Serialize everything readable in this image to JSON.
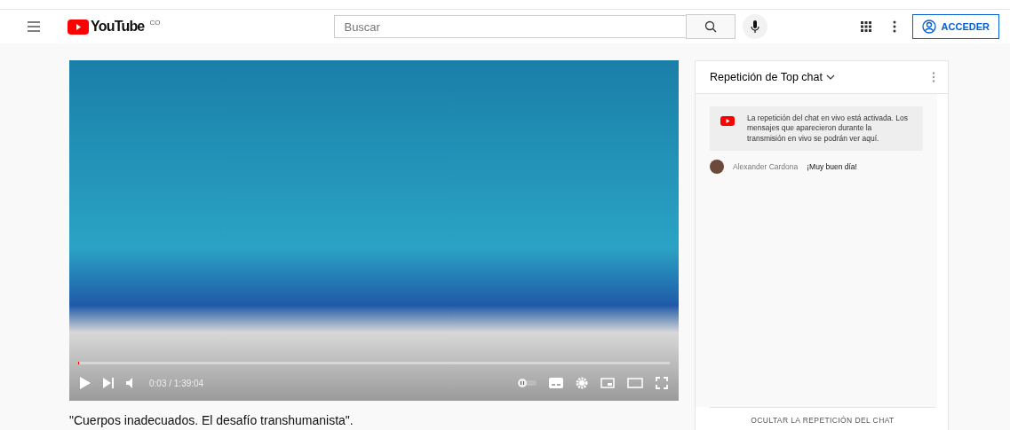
{
  "header": {
    "logo_text": "YouTube",
    "country": "CO",
    "search": {
      "placeholder": "Buscar"
    },
    "sign_in": "ACCEDER"
  },
  "player": {
    "progress": {
      "level": 0.001
    },
    "time": "0:03 / 1:39:04"
  },
  "video_title": "\"Cuerpos inadecuados. El desafío transhumanista\".",
  "chat": {
    "title": "Repetición de Top chat",
    "notice": "La repetición del chat en vivo está activada. Los mensajes que aparecieron durante la transmisión en vivo se podrán ver aquí.",
    "messages": [
      {
        "author": "Alexander Cardona",
        "text": "¡Muy buen día!"
      }
    ],
    "hide_button": "OCULTAR LA REPETICIÓN DEL CHAT"
  }
}
